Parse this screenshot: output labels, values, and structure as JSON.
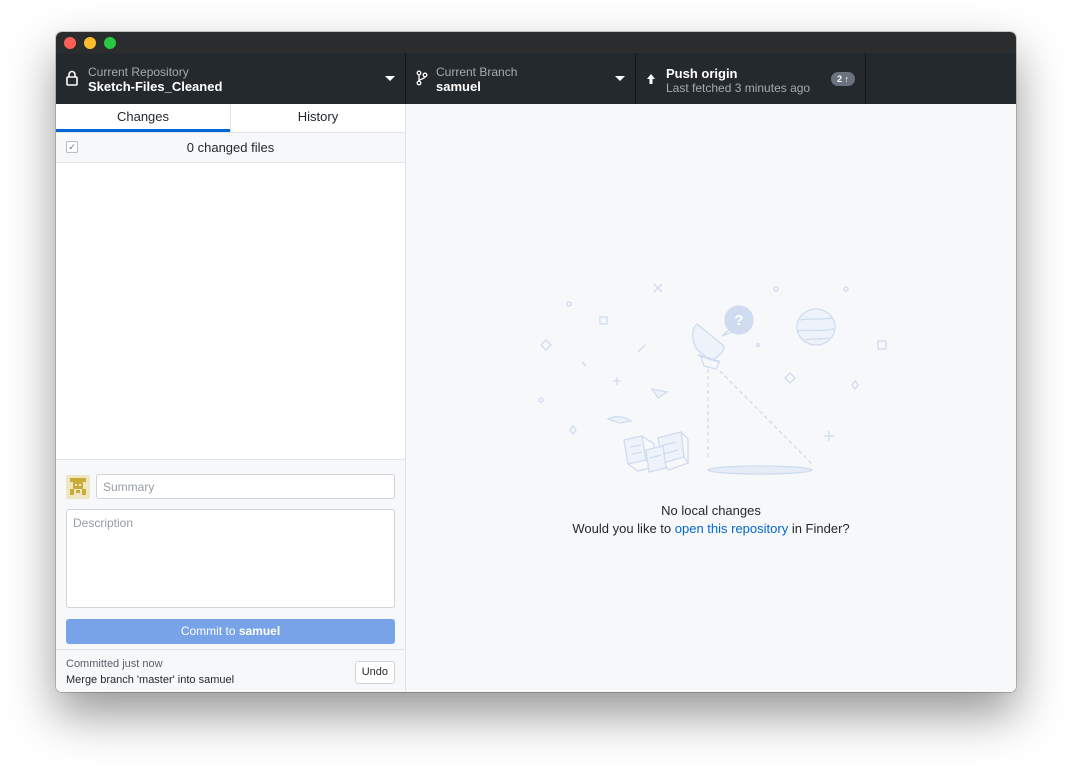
{
  "window": {
    "controls": [
      "close",
      "minimize",
      "zoom"
    ]
  },
  "toolbar": {
    "repository": {
      "label": "Current Repository",
      "value": "Sketch-Files_Cleaned",
      "icon": "lock-icon"
    },
    "branch": {
      "label": "Current Branch",
      "value": "samuel",
      "icon": "branch-icon"
    },
    "push": {
      "title": "Push origin",
      "subtitle": "Last fetched 3 minutes ago",
      "badge": "2 ↑",
      "icon": "arrow-up-icon"
    }
  },
  "sidebar": {
    "tabs": [
      {
        "label": "Changes",
        "selected": true
      },
      {
        "label": "History",
        "selected": false
      }
    ],
    "changes": {
      "count_label": "0 changed files",
      "select_all_checked": true
    },
    "commit": {
      "summary_placeholder": "Summary",
      "description_placeholder": "Description",
      "button_prefix": "Commit to ",
      "button_branch": "samuel"
    },
    "last_commit": {
      "time": "Committed just now",
      "message": "Merge branch 'master' into samuel",
      "undo_label": "Undo"
    }
  },
  "main": {
    "title": "No local changes",
    "message_prefix": "Would you like to ",
    "link_text": "open this repository",
    "message_suffix": " in Finder?"
  },
  "colors": {
    "toolbar_bg": "#24292e",
    "accent": "#0366d6",
    "commit_button": "#79a3e9",
    "illustration": "#cfdcf0"
  }
}
